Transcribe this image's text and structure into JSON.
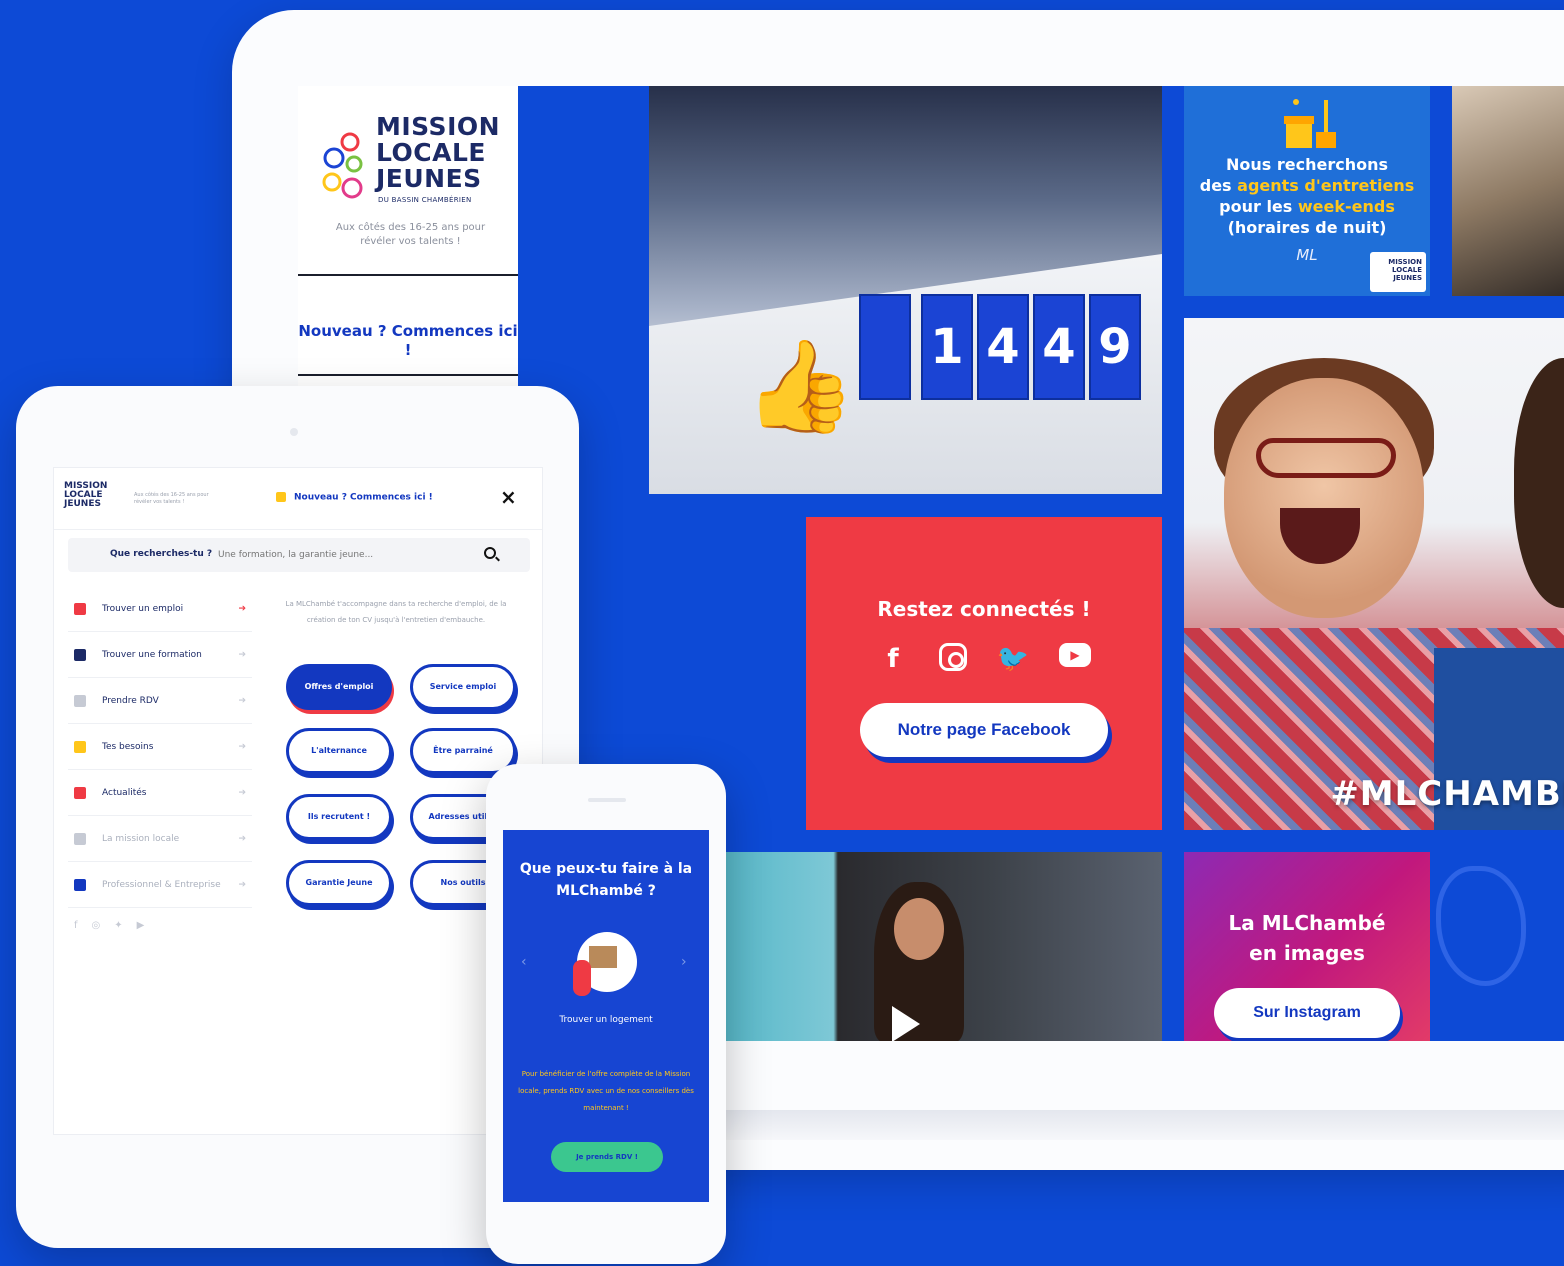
{
  "desktop": {
    "logo": {
      "line1": "MISSION",
      "line2": "LOCALE",
      "line3": "JEUNES",
      "sub": "DU BASSIN CHAMBÉRIEN"
    },
    "tagline": "Aux côtés des 16-25 ans pour révéler vos talents !",
    "new_here": "Nouveau ? Commences ici !",
    "counter_digits": [
      "1",
      "4",
      "4",
      "9"
    ],
    "recruit": {
      "line1": "Nous recherchons",
      "line2_prefix": "des ",
      "line2_highlight": "agents d'entretiens",
      "line3_prefix": "pour les ",
      "line3_highlight": "week-ends",
      "line4": "(horaires de nuit)",
      "signature": "ML",
      "mini_logo": "MISSION LOCALE JEUNES"
    },
    "hashtag": "#MLCHAMBÉ",
    "social": {
      "title": "Restez connectés !",
      "button": "Notre page Facebook",
      "icons": [
        "facebook-icon",
        "instagram-icon",
        "twitter-icon",
        "youtube-icon"
      ]
    },
    "insta": {
      "title_line1": "La MLChambé",
      "title_line2": "en images",
      "button": "Sur Instagram"
    }
  },
  "tablet": {
    "logo": "MISSION LOCALE JEUNES",
    "logo_sub": "Aux côtés des 16-25 ans pour révéler vos talents !",
    "new_here": "Nouveau ? Commences ici !",
    "close": "×",
    "search": {
      "label": "Que recherches-tu ?",
      "placeholder": "Une formation, la garantie jeune..."
    },
    "menu": [
      {
        "label": "Trouver un emploi",
        "color": "#ef3a44"
      },
      {
        "label": "Trouver une formation",
        "color": "#1c2a66"
      },
      {
        "label": "Prendre RDV",
        "color": "#c6cad4"
      },
      {
        "label": "Tes besoins",
        "color": "#ffc61a"
      },
      {
        "label": "Actualités",
        "color": "#ef3a44"
      },
      {
        "label": "La mission locale",
        "color": "#c6cad4"
      },
      {
        "label": "Professionnel & Entreprise",
        "color": "#1338c0"
      }
    ],
    "intro": "La MLChambé t'accompagne dans ta recherche d'emploi, de la création de ton CV jusqu'à l'entretien d'embauche.",
    "pills": [
      "Offres d'emploi",
      "Service emploi",
      "L'alternance",
      "Être parrainé",
      "Ils recrutent !",
      "Adresses utiles",
      "Garantie Jeune",
      "Nos outils"
    ]
  },
  "phone": {
    "title": "Que peux-tu faire à la MLChambé ?",
    "caption": "Trouver un logement",
    "text": "Pour bénéficier de l'offre complète de la Mission locale, prends RDV avec un de nos conseillers dès maintenant !",
    "cta": "Je prends RDV !"
  }
}
